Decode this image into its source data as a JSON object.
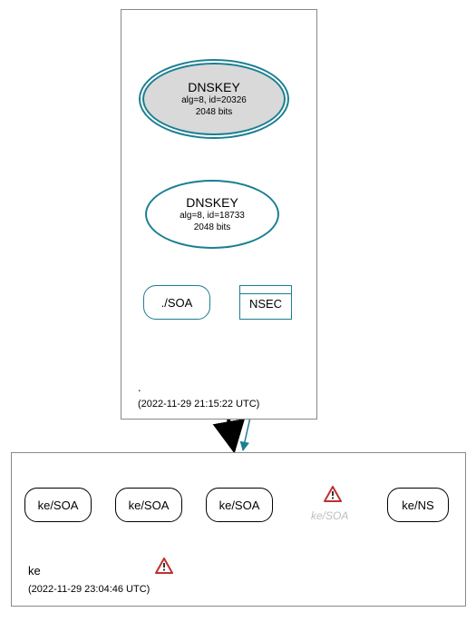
{
  "root_zone": {
    "ksk": {
      "title": "DNSKEY",
      "alg_id": "alg=8, id=20326",
      "bits": "2048 bits"
    },
    "zsk": {
      "title": "DNSKEY",
      "alg_id": "alg=8, id=18733",
      "bits": "2048 bits"
    },
    "soa_label": "./SOA",
    "nsec_label": "NSEC",
    "name": ".",
    "timestamp": "(2022-11-29 21:15:22 UTC)"
  },
  "ke_zone": {
    "items": [
      {
        "label": "ke/SOA"
      },
      {
        "label": "ke/SOA"
      },
      {
        "label": "ke/SOA"
      },
      {
        "label": "ke/SOA"
      },
      {
        "label": "ke/NS"
      }
    ],
    "name": "ke",
    "timestamp": "(2022-11-29 23:04:46 UTC)"
  }
}
